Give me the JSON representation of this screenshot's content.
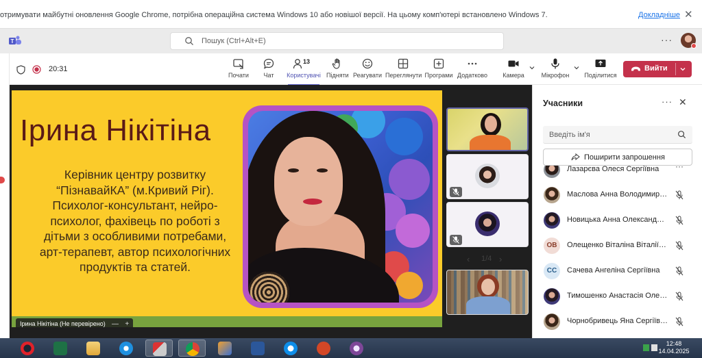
{
  "browser_infobar": {
    "message": "отримувати майбутні оновлення Google Chrome, потрібна операційна система Windows 10 або новішої версії. На цьому комп'ютері встановлено Windows 7.",
    "link": "Докладніше",
    "close": "✕"
  },
  "titlebar": {
    "search_placeholder": "Пошук (Ctrl+Alt+E)",
    "more": "···"
  },
  "toolbar": {
    "timer": "20:31",
    "buttons": {
      "chat": "Чат",
      "participants": "Користувачі",
      "participants_count": "13",
      "raise": "Підняти",
      "react": "Реагувати",
      "view": "Переглянути",
      "apps": "Програми",
      "more": "Додатково",
      "camera": "Камера",
      "mic": "Мікрофон",
      "share": "Поділитися"
    },
    "start_label": "Почати",
    "leave": "Вийти"
  },
  "slide": {
    "name": "Ірина Нікітіна",
    "description_lines": [
      "Керівник центру розвитку",
      "“ПізнавайКА” (м.Кривий Ріг).",
      "Психолог-консультант, нейро-",
      "психолог,  фахівець по роботі з",
      "дітьми з  особливими потребами,",
      "арт-терапевт, автор психологічних",
      "продуктів та статей."
    ]
  },
  "stage": {
    "presenter_tag": "Ірина Нікітіна (Не перевірено)",
    "tag_minus": "—",
    "tag_plus": "+",
    "pager": {
      "current_of_total": "1/4",
      "prev": "‹",
      "next": "›"
    }
  },
  "participants_panel": {
    "title": "Учасники",
    "more": "···",
    "close": "✕",
    "search_placeholder": "Введіть ім'я",
    "invite_label": "Поширити запрошення",
    "people": [
      {
        "name": "Лазарєва Олеся Сергіївна",
        "avatar": "photo-a",
        "initials": ""
      },
      {
        "name": "Маслова Анна Володимирівна",
        "avatar": "photo-b",
        "initials": ""
      },
      {
        "name": "Новицька Анна Олександрівна",
        "avatar": "photo-c",
        "initials": ""
      },
      {
        "name": "Олещенко Віталіна Віталіївна",
        "avatar": "ov",
        "initials": "ОВ"
      },
      {
        "name": "Сачева Ангеліна Сергіївна",
        "avatar": "cc",
        "initials": "СС"
      },
      {
        "name": "Тимошенко Анастасія Олександрівна",
        "avatar": "photo-c",
        "initials": ""
      },
      {
        "name": "Чорнобривець Яна Сергіївна",
        "avatar": "photo-b",
        "initials": ""
      }
    ]
  },
  "taskbar": {
    "time": "12:48",
    "date": "14.04.2025",
    "apps": [
      "opera",
      "excel",
      "explorer",
      "internet-explorer",
      "snipping-tool",
      "chrome",
      "media-player",
      "word",
      "teamviewer",
      "powerpoint",
      "tor-browser"
    ]
  },
  "colors": {
    "teams_accent": "#5b5fc7",
    "leave_red": "#c4314b",
    "slide_yellow": "#fbcb2a",
    "slide_title": "#5a1a17",
    "photo_frame": "#b553c4"
  }
}
